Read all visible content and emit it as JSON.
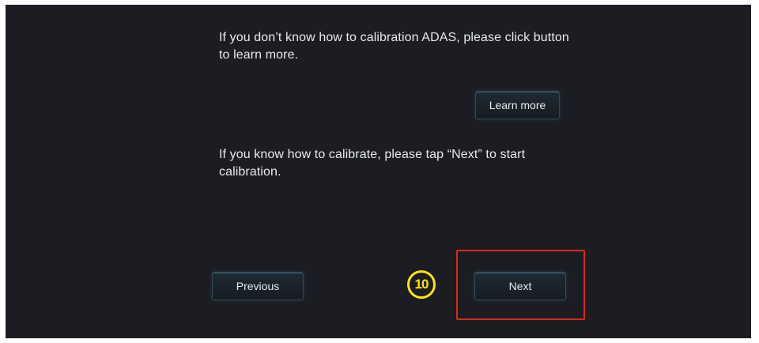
{
  "screen": {
    "instruction_learn": "If you don’t know how to calibration ADAS, please click button to learn more.",
    "learn_more_label": "Learn more",
    "instruction_next": "If you know how to calibrate, please tap “Next” to start calibration.",
    "previous_label": "Previous",
    "next_label": "Next"
  },
  "annotation": {
    "step_number": "10",
    "highlight_color": "#e0251f",
    "marker_color": "#ffe600"
  },
  "colors": {
    "background": "#1c1d22",
    "button_border": "#2f4a5a",
    "text": "#e8eaef"
  }
}
